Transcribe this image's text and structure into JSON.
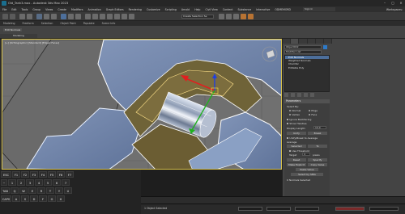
{
  "app": {
    "title": "Old_Tank3.max - Autodesk 3ds Max 2023",
    "window_buttons": [
      "–",
      "▢",
      "×"
    ]
  },
  "menu": {
    "items": [
      "File",
      "Edit",
      "Tools",
      "Group",
      "Views",
      "Create",
      "Modifiers",
      "Animation",
      "Graph Editors",
      "Rendering",
      "Customize",
      "Scripting",
      "Arnold",
      "Help",
      "Civil View",
      "Content",
      "Substance",
      "Interactive",
      "ODMEMORD"
    ],
    "sign_in": "Sign In",
    "workspace": "Workspaces:"
  },
  "toolbar": {
    "create_selection_set": "Create Selection Se"
  },
  "ribbon": {
    "tabs": [
      "Modeling",
      "Freeform",
      "Selection",
      "Object Paint",
      "Populate",
      "Scene Info"
    ],
    "edit_normals_button": "Edit Normals",
    "modeling_label": "Modeling",
    "polygon_modeling_label": "Polygon Modeling"
  },
  "viewport": {
    "label": "[+] [Orthographic] [Standard] [Edged Faces]"
  },
  "command_panel": {
    "object_name": "Object002",
    "modifier_list": "Modifier List",
    "stack": [
      {
        "label": "Edit Normals",
        "selected": true
      },
      {
        "label": "Weighted Normals",
        "selected": false
      },
      {
        "label": "Chamfer",
        "selected": false
      },
      {
        "label": "Editable Poly",
        "selected": false
      }
    ],
    "parameters": {
      "title": "Parameters",
      "select_by": "Select By:",
      "normal": "Normal",
      "edge": "Edge",
      "vertex": "Vertex",
      "face": "Face",
      "ignore_backfacing": "Ignore Backfacing",
      "show_handles": "Show Handles",
      "display_length": "Display Length:",
      "display_length_value": "10,0",
      "unify": "Unify",
      "break": "Break",
      "unify_break_to_average": "Unify/Break to Average",
      "average": "Average",
      "selected": "Selected",
      "to": "To",
      "use_threshold": "Use Threshold",
      "target": "Target",
      "target_value": "4",
      "pixels": "pixels",
      "reset": "Reset",
      "specify": "Specify",
      "explicit": "Make Explicit",
      "copy_value": "Copy Value",
      "paste_value": "Paste Value",
      "select_by_smg": "Select by SMG",
      "normals_selected": "0 Normals Selected"
    }
  },
  "keyboard": {
    "row1": [
      "ESC",
      "F1",
      "F2",
      "F3",
      "F4",
      "F5",
      "F6",
      "F7"
    ],
    "row2": [
      "~",
      "1",
      "2",
      "3",
      "4",
      "5",
      "6",
      "7"
    ],
    "row3": [
      "TAB",
      "Q",
      "W",
      "E",
      "R",
      "T",
      "Y",
      "U"
    ],
    "row4": [
      "CAPS",
      "A",
      "S",
      "D",
      "F",
      "G",
      "H"
    ]
  },
  "status": {
    "text": "1 Object Selected"
  },
  "colors": {
    "accent": "#2d79c7",
    "selected_stack": "#4d6f9b",
    "viewport_border": "#d9c24a",
    "gizmo_x": "#e02020",
    "gizmo_y": "#20b020",
    "gizmo_z": "#2040e0"
  }
}
